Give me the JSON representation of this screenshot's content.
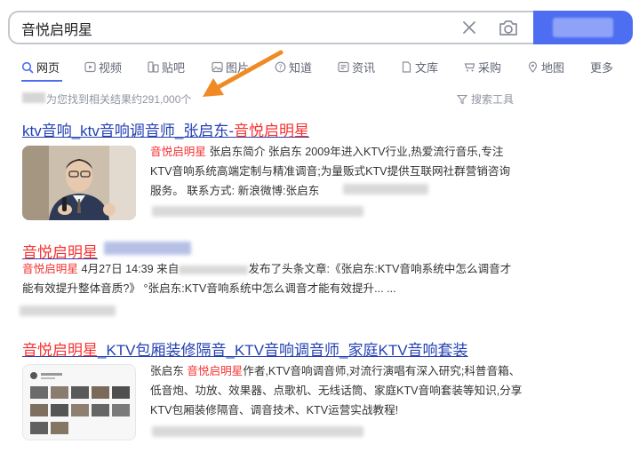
{
  "search": {
    "query": "音悦启明星"
  },
  "tabs": [
    {
      "label": "网页",
      "icon": "search-icon",
      "active": true
    },
    {
      "label": "视频",
      "icon": "video-icon"
    },
    {
      "label": "贴吧",
      "icon": "tieba-icon"
    },
    {
      "label": "图片",
      "icon": "image-icon"
    },
    {
      "label": "知道",
      "icon": "question-icon"
    },
    {
      "label": "资讯",
      "icon": "news-icon"
    },
    {
      "label": "文库",
      "icon": "doc-icon"
    },
    {
      "label": "采购",
      "icon": "cart-icon"
    },
    {
      "label": "地图",
      "icon": "map-icon"
    },
    {
      "label": "更多",
      "icon": ""
    }
  ],
  "result_count": "为您找到相关结果约291,000个",
  "search_tools": "搜索工具",
  "results": [
    {
      "title_blue": "ktv音响_ktv音响调音师_张启东-",
      "title_red": "音悦启明星",
      "snippet_red": "音悦启明星",
      "snippet": " 张启东简介 张启东 2009年进入KTV行业,热爱流行音乐,专注KTV音响系统高端定制与精准调音;为量贩式KTV提供互联网社群营销咨询服务。 联系方式: 新浪微博:张启东"
    },
    {
      "title_red": "音悦启明星",
      "meta_red": "音悦启明星",
      "meta": " 4月27日 14:39 来自",
      "meta_tail": "发布了头条文章:《张启东:KTV音响系统中怎么调音才能有效提升整体音质?》 °张启东:KTV音响系统中怎么调音才能有效提升... ..."
    },
    {
      "title_red": "音悦启明星",
      "title_blue": "_KTV包厢装修隔音_KTV音响调音师_家庭KTV音响套装",
      "snippet_pre": "张启东 ",
      "snippet_red": "音悦启明星",
      "snippet": "作者,KTV音响调音师,对流行演唱有深入研究;科普音箱、低音炮、功放、效果器、点歌机、无线话筒、家庭KTV音响套装等知识,分享KTV包厢装修隔音、调音技术、KTV运营实战教程!"
    }
  ],
  "colors": {
    "accent": "#4e6ef2",
    "link": "#2440b3",
    "highlight": "#f73131",
    "arrow": "#f08a24"
  }
}
